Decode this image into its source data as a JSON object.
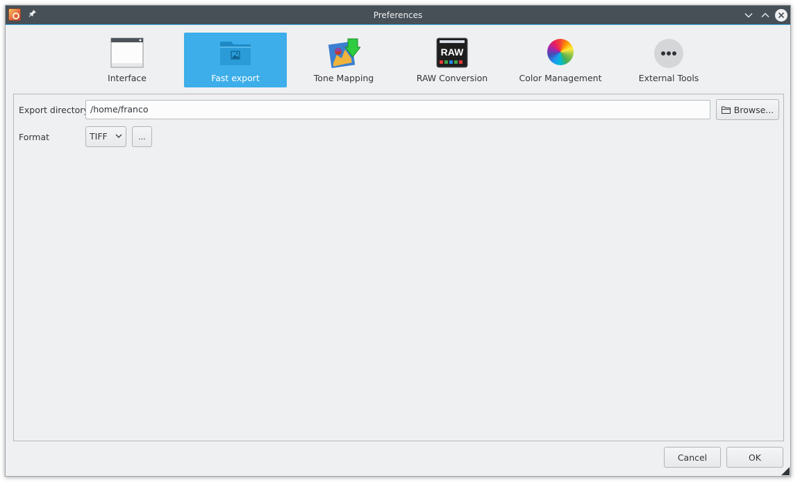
{
  "window": {
    "title": "Preferences",
    "colors": {
      "titlebar": "#475057",
      "accent": "#3daee9",
      "background": "#eff0f1"
    }
  },
  "pages": [
    {
      "label": "Interface",
      "icon": "window-icon",
      "active": false
    },
    {
      "label": "Fast export",
      "icon": "folder-image-icon",
      "active": true
    },
    {
      "label": "Tone Mapping",
      "icon": "tone-mapping-icon",
      "active": false
    },
    {
      "label": "RAW Conversion",
      "icon": "raw-icon",
      "active": false
    },
    {
      "label": "Color Management",
      "icon": "color-wheel-icon",
      "active": false
    },
    {
      "label": "External Tools",
      "icon": "more-dots-icon",
      "active": false
    }
  ],
  "fast_export": {
    "export_directory_label": "Export directory",
    "export_directory_value": "/home/franco",
    "browse_label": "Browse...",
    "format_label": "Format",
    "format_value": "TIFF",
    "options_label": "..."
  },
  "buttons": {
    "cancel": "Cancel",
    "ok": "OK"
  }
}
